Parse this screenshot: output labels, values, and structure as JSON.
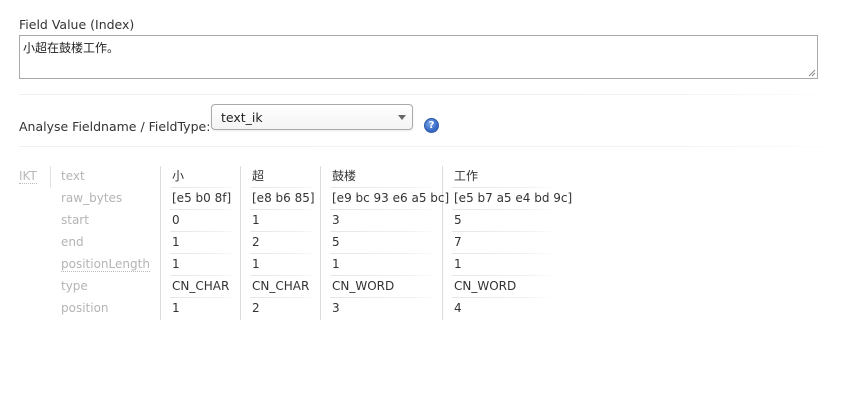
{
  "field_value": {
    "label": "Field Value (Index)",
    "text": "小超在鼓楼工作。"
  },
  "analyse": {
    "label": "Analyse Fieldname / FieldType:",
    "selected": "text_ik",
    "help_symbol": "?"
  },
  "analysis": {
    "stage": "IKT",
    "rows": [
      {
        "name": "text",
        "values": [
          "小",
          "超",
          "鼓楼",
          "工作"
        ]
      },
      {
        "name": "raw_bytes",
        "values": [
          "[e5 b0 8f]",
          "[e8 b6 85]",
          "[e9 bc 93 e6 a5 bc]",
          "[e5 b7 a5 e4 bd 9c]"
        ]
      },
      {
        "name": "start",
        "values": [
          "0",
          "1",
          "3",
          "5"
        ]
      },
      {
        "name": "end",
        "values": [
          "1",
          "2",
          "5",
          "7"
        ]
      },
      {
        "name": "positionLength",
        "values": [
          "1",
          "1",
          "1",
          "1"
        ]
      },
      {
        "name": "type",
        "values": [
          "CN_CHAR",
          "CN_CHAR",
          "CN_WORD",
          "CN_WORD"
        ]
      },
      {
        "name": "position",
        "values": [
          "1",
          "2",
          "3",
          "4"
        ]
      }
    ]
  }
}
